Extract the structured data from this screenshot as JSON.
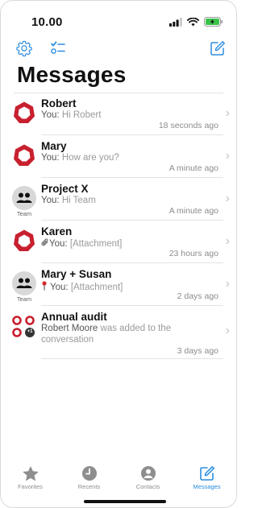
{
  "status_bar": {
    "time": "10.00",
    "icons": [
      "signal-icon",
      "wifi-icon",
      "battery-charging-icon"
    ]
  },
  "toolbar": {
    "left_icons": [
      "gear-icon",
      "checklist-icon"
    ],
    "right_icon": "compose-icon",
    "accent_color": "#2b8de0"
  },
  "page_title": "Messages",
  "conversations": [
    {
      "name": "Robert",
      "sender": "You:",
      "text": "Hi Robert",
      "time": "18 seconds ago",
      "avatar": "logo"
    },
    {
      "name": "Mary",
      "sender": "You:",
      "text": "How are you?",
      "time": "A minute ago",
      "avatar": "logo"
    },
    {
      "name": "Project X",
      "sender": "You:",
      "text": "Hi Team",
      "time": "A minute ago",
      "avatar": "team",
      "avatar_label": "Team"
    },
    {
      "name": "Karen",
      "sender": "You:",
      "text": "[Attachment]",
      "time": "23 hours ago",
      "avatar": "logo",
      "prefix_icon": "paperclip-icon"
    },
    {
      "name": "Mary + Susan",
      "sender": "You:",
      "text": "[Attachment]",
      "time": "2 days ago",
      "avatar": "team",
      "avatar_label": "Team",
      "prefix_icon": "pin-icon"
    },
    {
      "name": "Annual audit",
      "sender": "Robert Moore",
      "text": "was added to the",
      "text2": "conversation",
      "time": "3 days ago",
      "avatar": "multi",
      "badge": "+1"
    }
  ],
  "tabbar": {
    "tabs": [
      {
        "label": "Favorites",
        "icon": "star-icon",
        "active": false
      },
      {
        "label": "Recents",
        "icon": "clock-icon",
        "active": false
      },
      {
        "label": "Contacts",
        "icon": "person-icon",
        "active": false
      },
      {
        "label": "Messages",
        "icon": "compose-icon",
        "active": true
      }
    ]
  }
}
